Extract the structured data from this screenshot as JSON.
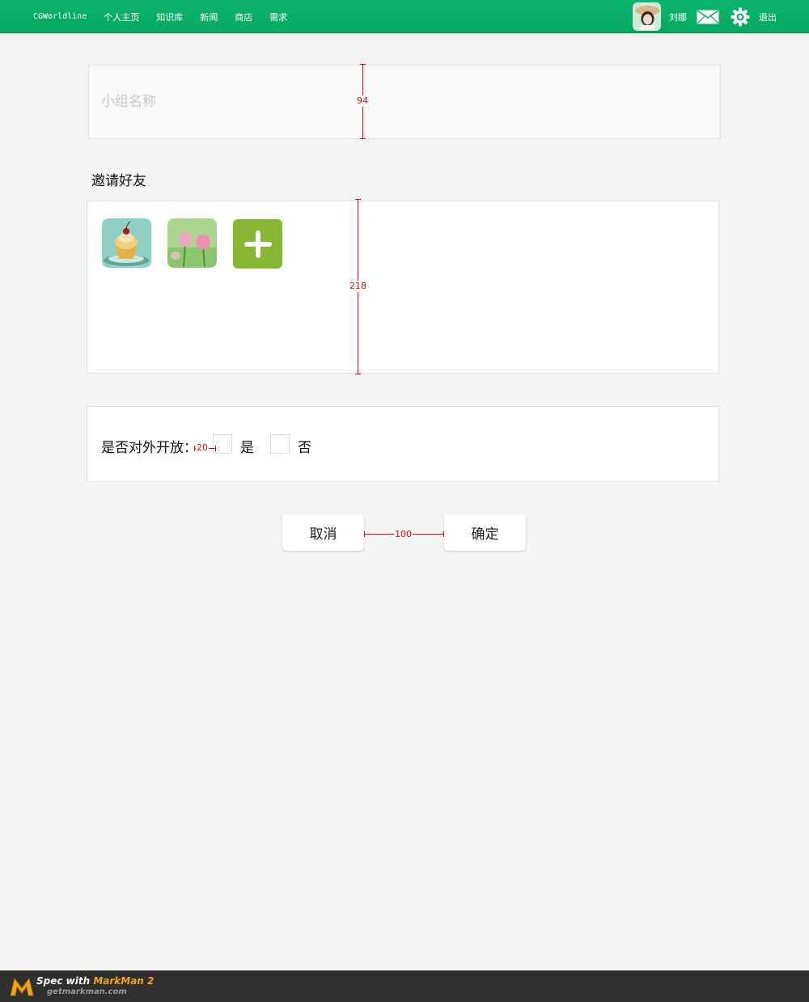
{
  "nav": {
    "brand": "CGWorldline",
    "items": [
      "个人主页",
      "知识库",
      "新闻",
      "商店",
      "需求"
    ]
  },
  "user": {
    "name": "刘娜",
    "logout": "退出"
  },
  "form": {
    "name_placeholder": "小组名称",
    "invite_title": "邀请好友",
    "open_label": "是否对外开放：",
    "option_yes": "是",
    "option_no": "否",
    "cancel_label": "取消",
    "confirm_label": "确定"
  },
  "annotations": {
    "name_box_height": "94",
    "friends_box_height": "218",
    "checkbox_gap": "20",
    "button_gap": "100"
  },
  "footer": {
    "spec_with": "Spec with",
    "brand": "MarkMan 2",
    "site": "getmarkman.com"
  },
  "colors": {
    "topbar_green": "#0cb56e",
    "add_button": "#87b733",
    "annotation_red": "#d01010"
  }
}
